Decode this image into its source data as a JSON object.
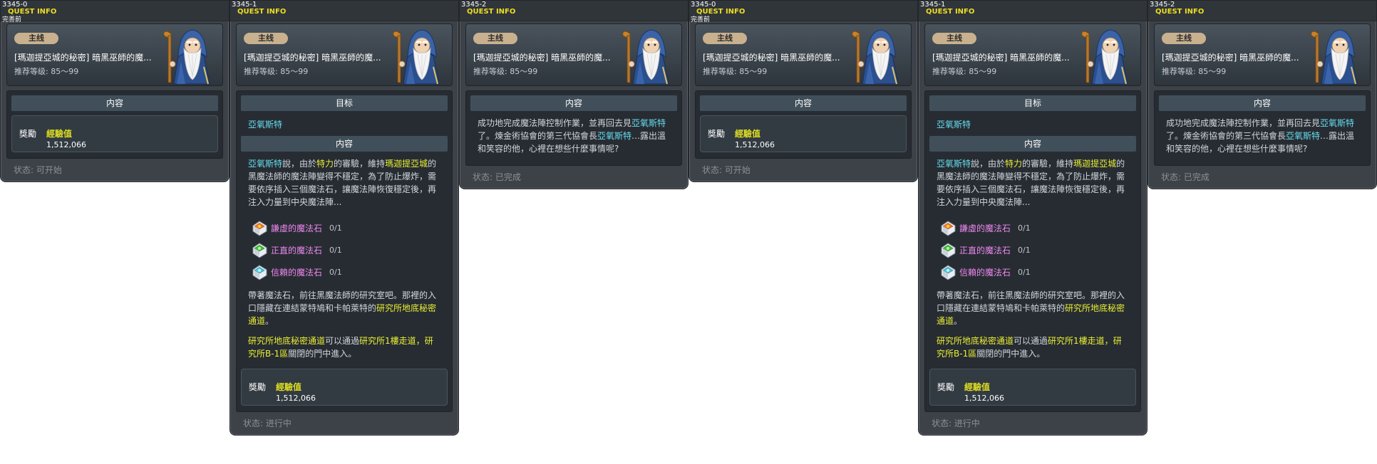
{
  "common": {
    "quest_info": "QUEST INFO",
    "badge": "主线",
    "quest_name": "[瑪迦提亞城的秘密] 暗黑巫師的魔...",
    "level": "推荐等级: 85～99",
    "header_target": "目标",
    "header_content": "内容",
    "target_npc": "亞氧斯特",
    "reward_label": "獎勵",
    "exp_label": "經驗值",
    "exp_value": "1,512,066",
    "colors": {
      "accent_yellow": "#e8ee33",
      "accent_cyan": "#66ddee",
      "magic_stone": "#ee88ee"
    }
  },
  "progress": {
    "p1_a": "亞氧斯特",
    "p1_b": "說，由於",
    "p1_c": "特力",
    "p1_d": "的審驗，維持",
    "p1_e": "瑪迦提亞城",
    "p1_f": "的黑魔法師的魔法陣變得不穩定，為了防止爆炸，需要依序插入三個魔法石，讓魔法陣恢復穩定後，再注入力量到中央魔法陣...",
    "items": [
      {
        "name": "謙虛的魔法石",
        "count": "0/1",
        "icon": "orange-stone-icon"
      },
      {
        "name": "正直的魔法石",
        "count": "0/1",
        "icon": "green-stone-icon"
      },
      {
        "name": "信賴的魔法石",
        "count": "0/1",
        "icon": "blue-stone-icon"
      }
    ],
    "p2_a": "帶著魔法石，前往黑魔法師的研究室吧。那裡的入口隱藏在連結蒙特鳩和卡帕萊特的",
    "p2_b": "研究所地底秘密通道",
    "p2_c": "。",
    "p3_a": "研究所地底秘密通道",
    "p3_b": "可以通過",
    "p3_c": "研究所1樓走道",
    "p3_d": "，",
    "p3_e": "研究所B-1區",
    "p3_f": "關閉的門中進入。"
  },
  "complete": {
    "c_a": "成功地完成魔法陣控制作業，並再回去見",
    "c_b": "亞氧斯特",
    "c_c": "了。煉金術協會的第三代協會長",
    "c_d": "亞氧斯特",
    "c_e": "…露出溫和笑容的他，心裡在想些什麼事情呢?"
  },
  "windows": [
    {
      "id": "3345-0",
      "subtitle": "完善前",
      "status": "状态: 可开始"
    },
    {
      "id": "3345-1",
      "subtitle": "",
      "status": "状态: 进行中"
    },
    {
      "id": "3345-2",
      "subtitle": "",
      "status": "状态: 已完成"
    },
    {
      "id": "3345-0",
      "subtitle": "完善前",
      "status": "状态: 可开始"
    },
    {
      "id": "3345-1",
      "subtitle": "",
      "status": "状态: 进行中"
    },
    {
      "id": "3345-2",
      "subtitle": "",
      "status": "状态: 已完成"
    }
  ]
}
